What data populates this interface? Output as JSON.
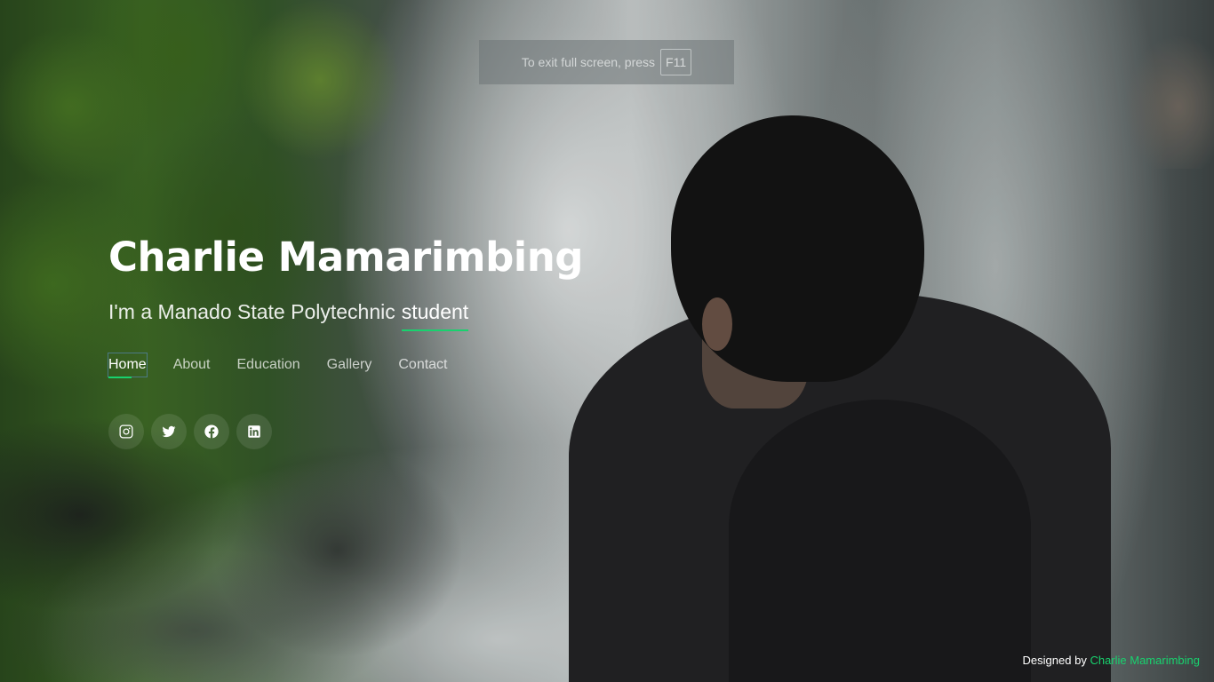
{
  "fullscreen_notice": {
    "text": "To exit full screen, press",
    "key": "F11"
  },
  "hero": {
    "name": "Charlie Mamarimbing",
    "subtitle_prefix": "I'm a Manado State Polytechnic",
    "subtitle_typed": "student"
  },
  "nav": {
    "items": [
      {
        "label": "Home",
        "active": true
      },
      {
        "label": "About"
      },
      {
        "label": "Education"
      },
      {
        "label": "Gallery"
      },
      {
        "label": "Contact"
      }
    ]
  },
  "social": {
    "icons": [
      "instagram-icon",
      "twitter-icon",
      "facebook-icon",
      "linkedin-icon"
    ]
  },
  "credits": {
    "prefix": "Designed by",
    "author": "Charlie Mamarimbing"
  },
  "colors": {
    "accent": "#18d26e",
    "text": "#ffffff"
  }
}
